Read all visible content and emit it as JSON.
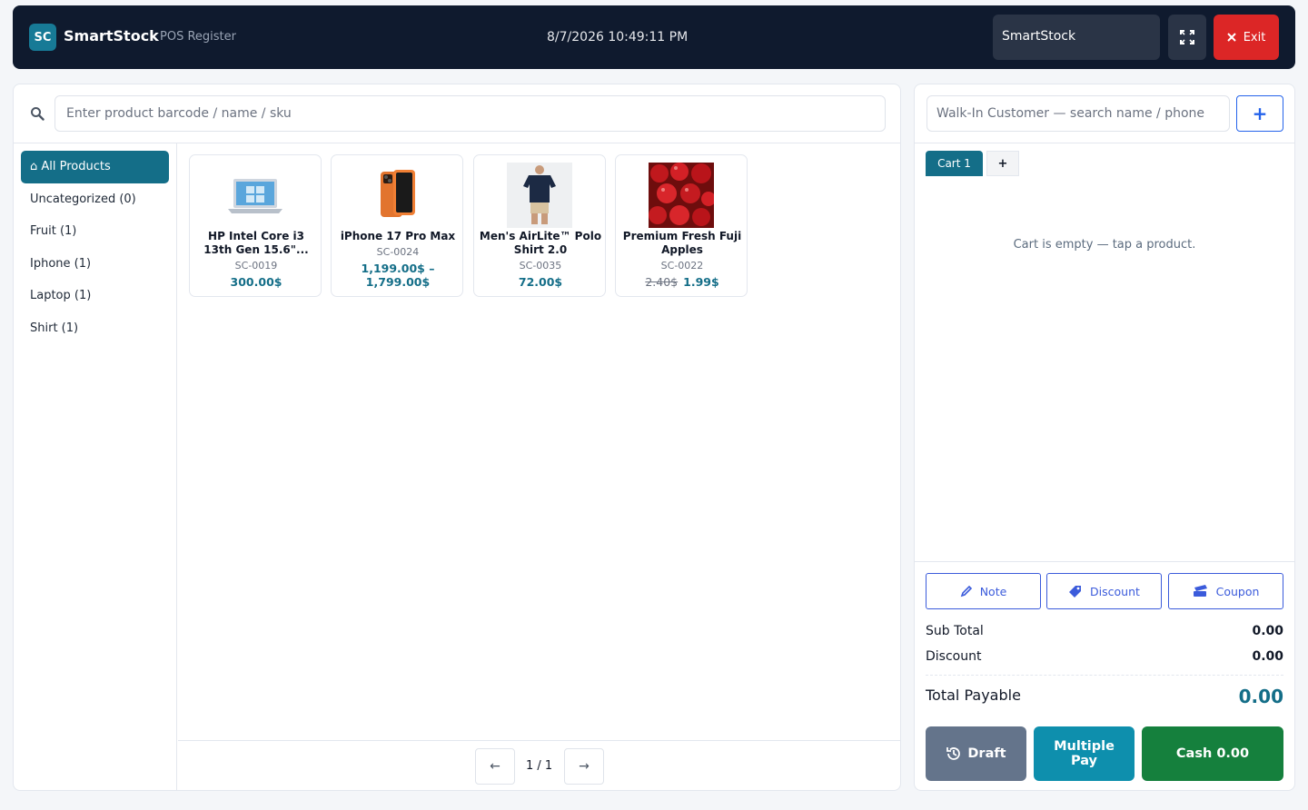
{
  "header": {
    "logo_text": "SC",
    "app_name": "SmartStock",
    "app_subtitle": "POS Register",
    "datetime": "8/7/2026 10:49:11 PM",
    "store": "SmartStock",
    "exit_label": "Exit"
  },
  "search": {
    "placeholder": "Enter product barcode / name / sku"
  },
  "categories": [
    "⌂ All Products",
    "Uncategorized (0)",
    "Fruit (1)",
    "Iphone (1)",
    "Laptop (1)",
    "Shirt (1)"
  ],
  "products": [
    {
      "name": "HP Intel Core i3 13th Gen 15.6\"...",
      "sku": "SC-0019",
      "price": "300.00$",
      "old_price": ""
    },
    {
      "name": "iPhone 17 Pro Max",
      "sku": "SC-0024",
      "price": "1,199.00$ – 1,799.00$",
      "old_price": ""
    },
    {
      "name": "Men's AirLite™ Polo Shirt 2.0",
      "sku": "SC-0035",
      "price": "72.00$",
      "old_price": ""
    },
    {
      "name": "Premium Fresh Fuji Apples",
      "sku": "SC-0022",
      "price": "1.99$",
      "old_price": "2.40$"
    }
  ],
  "pagination": {
    "prev": "←",
    "label": "1 / 1",
    "next": "→"
  },
  "customer": {
    "placeholder": "Walk-In Customer — search name / phone",
    "add_label": "+"
  },
  "cart": {
    "tab_label": "Cart 1",
    "add_tab_label": "+",
    "empty_text": "Cart is empty — tap a product."
  },
  "actions": {
    "note": "Note",
    "discount": "Discount",
    "coupon": "Coupon"
  },
  "summary": {
    "subtotal_label": "Sub Total",
    "subtotal": "0.00",
    "discount_label": "Discount",
    "discount": "0.00",
    "total_label": "Total Payable",
    "total": "0.00"
  },
  "payment": {
    "draft": "Draft",
    "multiple_line1": "Multiple",
    "multiple_line2": "Pay",
    "cash": "Cash 0.00"
  },
  "colors": {
    "header_bg": "#0f1a2e",
    "accent": "#146e88",
    "exit": "#dc2626",
    "draft": "#64748b",
    "multiple_pay": "#0e8fad",
    "cash": "#15803d",
    "action_border": "#3b5bdb"
  }
}
